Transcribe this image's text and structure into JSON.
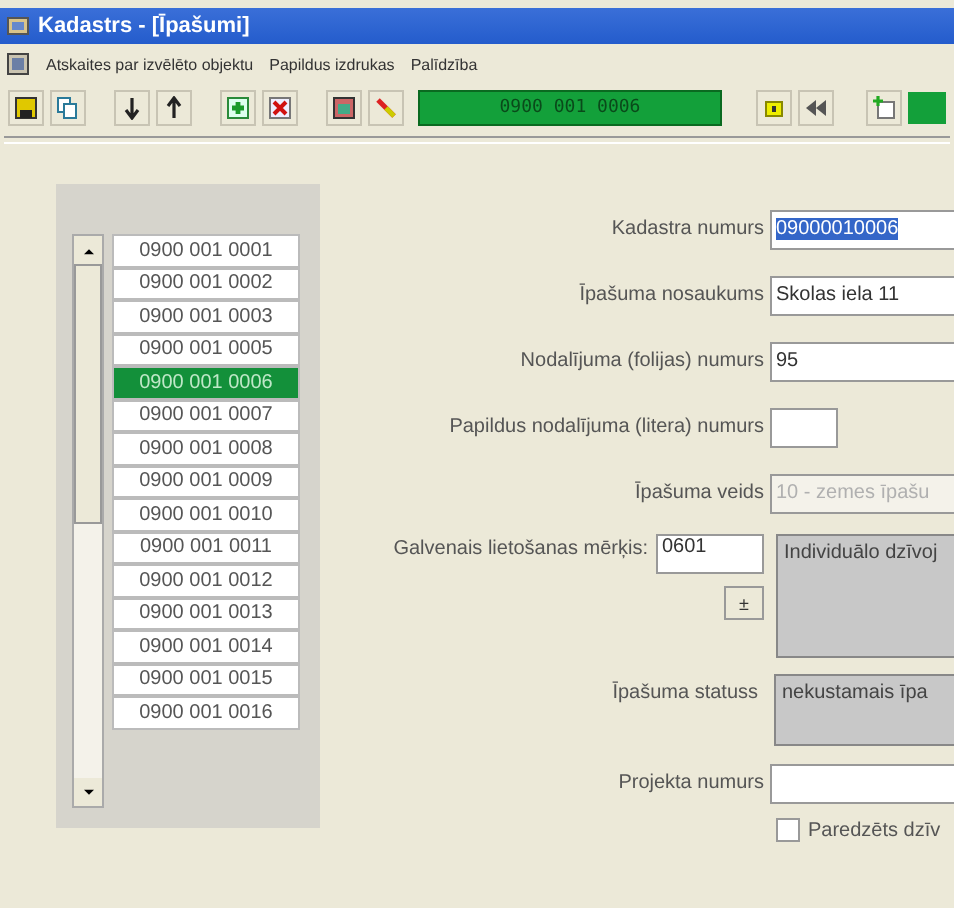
{
  "window": {
    "title": "Kadastrs - [Īpašumi]"
  },
  "menu": [
    "Atskaites par izvēlēto objektu",
    "Papildus izdrukas",
    "Palīdzība"
  ],
  "toolbar": {
    "display": "0900 001 0006"
  },
  "list": [
    {
      "label": "0900 001 0001",
      "selected": false
    },
    {
      "label": "0900 001 0002",
      "selected": false
    },
    {
      "label": "0900 001 0003",
      "selected": false
    },
    {
      "label": "0900 001 0005",
      "selected": false
    },
    {
      "label": "0900 001 0006",
      "selected": true
    },
    {
      "label": "0900 001 0007",
      "selected": false
    },
    {
      "label": "0900 001 0008",
      "selected": false
    },
    {
      "label": "0900 001 0009",
      "selected": false
    },
    {
      "label": "0900 001 0010",
      "selected": false
    },
    {
      "label": "0900 001 0011",
      "selected": false
    },
    {
      "label": "0900 001 0012",
      "selected": false
    },
    {
      "label": "0900 001 0013",
      "selected": false
    },
    {
      "label": "0900 001 0014",
      "selected": false
    },
    {
      "label": "0900 001 0015",
      "selected": false
    },
    {
      "label": "0900 001 0016",
      "selected": false
    }
  ],
  "fields": [
    {
      "label": "Kadastra numurs",
      "value": "09000010006",
      "kind": "highlighted"
    },
    {
      "label": "Īpašuma nosaukums",
      "value": "Skolas iela 11",
      "kind": "text"
    },
    {
      "label": "Nodalījuma (folijas) numurs",
      "value": "95",
      "kind": "text"
    },
    {
      "label": "Papildus nodalījuma (litera) numurs",
      "kind": "short"
    },
    {
      "label": "Īpašuma veids",
      "value": "10 - zemes īpašu",
      "kind": "disabled"
    }
  ],
  "purpose": {
    "label": "Galvenais lietošanas mērķis:",
    "code": "0601",
    "button": "±",
    "description": "Individuālo dzīvoj"
  },
  "status": {
    "label": "Īpašuma statuss",
    "value": "nekustamais īpa"
  },
  "project": {
    "label": "Projekta numurs"
  },
  "planned": {
    "label": "Paredzēts dzīv",
    "checked": false
  }
}
